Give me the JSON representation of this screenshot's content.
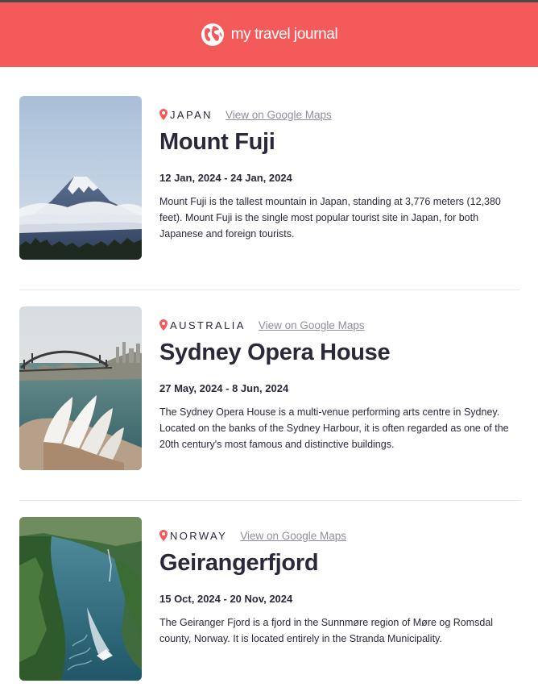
{
  "header": {
    "brand": "my travel journal",
    "icon": "globe-icon"
  },
  "colors": {
    "header_bg": "#f55a5a",
    "pin": "#f55a5a",
    "link": "#918e9b",
    "text": "#2b283a"
  },
  "entries": [
    {
      "country": "JAPAN",
      "map_link": "View on Google Maps",
      "title": "Mount Fuji",
      "dates": "12 Jan, 2024 - 24 Jan, 2024",
      "description": "Mount Fuji is the tallest mountain in Japan, standing at 3,776 meters (12,380 feet). Mount Fuji is the single most popular tourist site in Japan, for both Japanese and foreign tourists."
    },
    {
      "country": "AUSTRALIA",
      "map_link": "View on Google Maps",
      "title": "Sydney Opera House",
      "dates": "27 May, 2024 - 8 Jun, 2024",
      "description": "The Sydney Opera House is a multi-venue performing arts centre in Sydney. Located on the banks of the Sydney Harbour, it is often regarded as one of the 20th century's most famous and distinctive buildings."
    },
    {
      "country": "NORWAY",
      "map_link": "View on Google Maps",
      "title": "Geirangerfjord",
      "dates": "15 Oct, 2024 - 20 Nov, 2024",
      "description": "The Geiranger Fjord is a fjord in the Sunnmøre region of Møre og Romsdal county, Norway. It is located entirely in the Stranda Municipality."
    }
  ]
}
